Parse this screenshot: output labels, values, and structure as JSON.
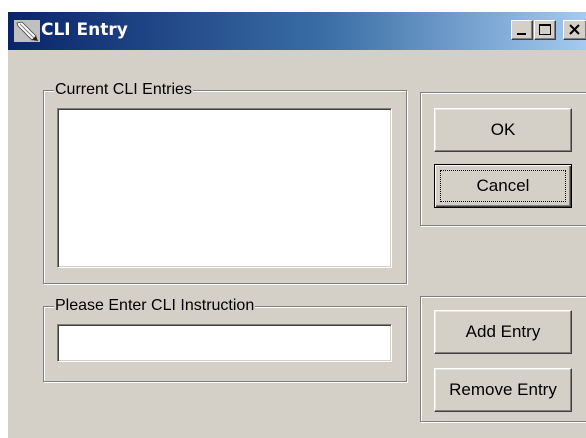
{
  "window": {
    "title": "CLI Entry",
    "icon": "pencil-icon",
    "controls": {
      "minimize": "minimize-icon",
      "maximize": "maximize-icon",
      "close": "close-icon"
    }
  },
  "entries_group": {
    "label": "Current CLI Entries",
    "items": []
  },
  "instruction_group": {
    "label": "Please Enter CLI Instruction",
    "value": ""
  },
  "buttons": {
    "ok": "OK",
    "cancel": "Cancel",
    "add": "Add Entry",
    "remove": "Remove Entry"
  },
  "colors": {
    "face": "#d4d0c8",
    "titlebar_start": "#0a246a",
    "titlebar_end": "#a6caf0"
  }
}
